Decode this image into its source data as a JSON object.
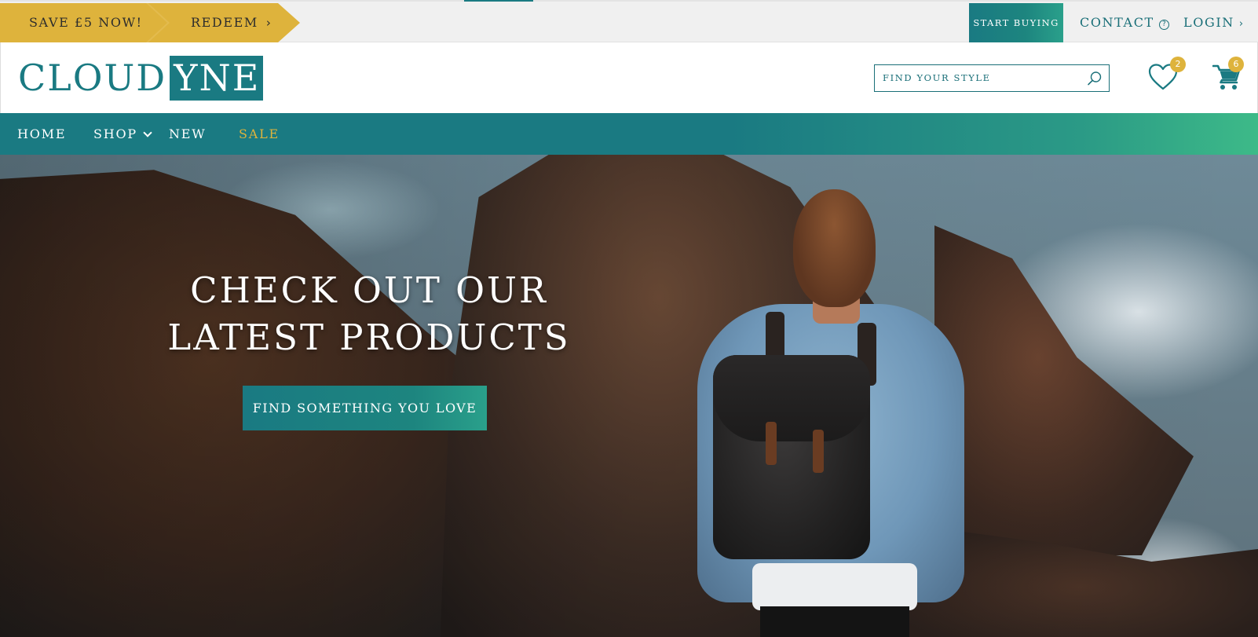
{
  "topbar": {
    "promo_save": "SAVE £5 NOW!",
    "promo_redeem": "REDEEM",
    "start_buying": "START BUYING",
    "contact": "CONTACT",
    "login": "LOGIN"
  },
  "header": {
    "logo_part1": "CLOUD",
    "logo_part2": "YNE",
    "search_placeholder": "FIND YOUR STYLE",
    "wishlist_count": "2",
    "cart_count": "6"
  },
  "nav": {
    "items": [
      {
        "label": "HOME"
      },
      {
        "label": "SHOP"
      },
      {
        "label": "NEW"
      },
      {
        "label": "SALE"
      }
    ]
  },
  "hero": {
    "title_line1": "CHECK OUT OUR",
    "title_line2": "LATEST PRODUCTS",
    "cta": "FIND SOMETHING YOU LOVE"
  },
  "colors": {
    "brand_teal": "#1a7a82",
    "accent_gold": "#deb33c",
    "gradient_end": "#3dba88"
  },
  "icons": {
    "help": "help-icon",
    "search": "search-icon",
    "wishlist": "heart-icon",
    "cart": "cart-icon",
    "chevron": "chevron-right-icon",
    "caret": "chevron-down-icon"
  }
}
